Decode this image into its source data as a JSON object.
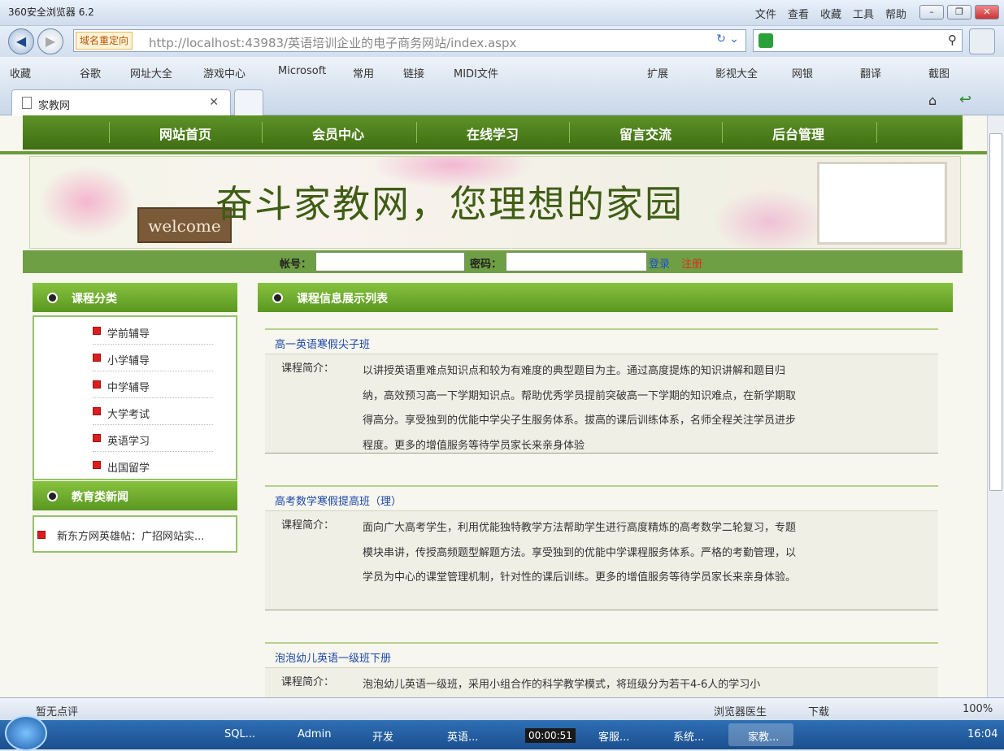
{
  "browser": {
    "title": "360安全浏览器 6.2",
    "menus": [
      "文件",
      "查看",
      "收藏",
      "工具",
      "帮助"
    ],
    "redirect_label": "域名重定向",
    "url": "http://localhost:43983/英语培训企业的电子商务网站/index.aspx",
    "favorites": [
      "收藏",
      "谷歌",
      "网址大全",
      "游戏中心",
      "Microsoft",
      "常用",
      "链接",
      "MIDI文件",
      "扩展",
      "影视大全",
      "网银",
      "翻译",
      "截图"
    ],
    "tab_title": "家教网"
  },
  "site": {
    "nav": [
      "网站首页",
      "会员中心",
      "在线学习",
      "留言交流",
      "后台管理"
    ],
    "banner": {
      "welcome": "welcome",
      "slogan": "奋斗家教网，您理想的家园"
    },
    "login": {
      "account_label": "帐号：",
      "password_label": "密码：",
      "login_link": "登录",
      "register_link": "注册"
    },
    "sidebar": {
      "category_title": "课程分类",
      "categories": [
        "学前辅导",
        "小学辅导",
        "中学辅导",
        "大学考试",
        "英语学习",
        "出国留学"
      ],
      "news_title": "教育类新闻",
      "news": [
        "新东方网英雄帖：广招网站实..."
      ]
    },
    "main": {
      "title": "课程信息展示列表",
      "intro_label": "课程简介：",
      "courses": [
        {
          "title": "高一英语寒假尖子班",
          "desc": "以讲授英语重难点知识点和较为有难度的典型题目为主。通过高度提炼的知识讲解和题目归纳，高效预习高一下学期知识点。帮助优秀学员提前突破高一下学期的知识难点，在新学期取得高分。享受独到的优能中学尖子生服务体系。拔高的课后训练体系，名师全程关注学员进步程度。更多的增值服务等待学员家长来亲身体验"
        },
        {
          "title": "高考数学寒假提高班（理）",
          "desc": "面向广大高考学生，利用优能独特教学方法帮助学生进行高度精炼的高考数学二轮复习，专题模块串讲，传授高频题型解题方法。享受独到的优能中学课程服务体系。严格的考勤管理，以学员为中心的课堂管理机制，针对性的课后训练。更多的增值服务等待学员家长来亲身体验。"
        },
        {
          "title": "泡泡幼儿英语一级班下册",
          "desc": "泡泡幼儿英语一级班，采用小组合作的科学教学模式，将班级分为若干4-6人的学习小"
        }
      ]
    }
  },
  "status": {
    "comment": "暂无点评",
    "doctor": "浏览器医生",
    "download": "下载",
    "zoom": "100%"
  },
  "taskbar": {
    "items": [
      "SQL...",
      "Admin",
      "开发",
      "英语...",
      "客服...",
      "系统...",
      "家教..."
    ],
    "timer": "00:00:51",
    "clock": "16:04"
  }
}
